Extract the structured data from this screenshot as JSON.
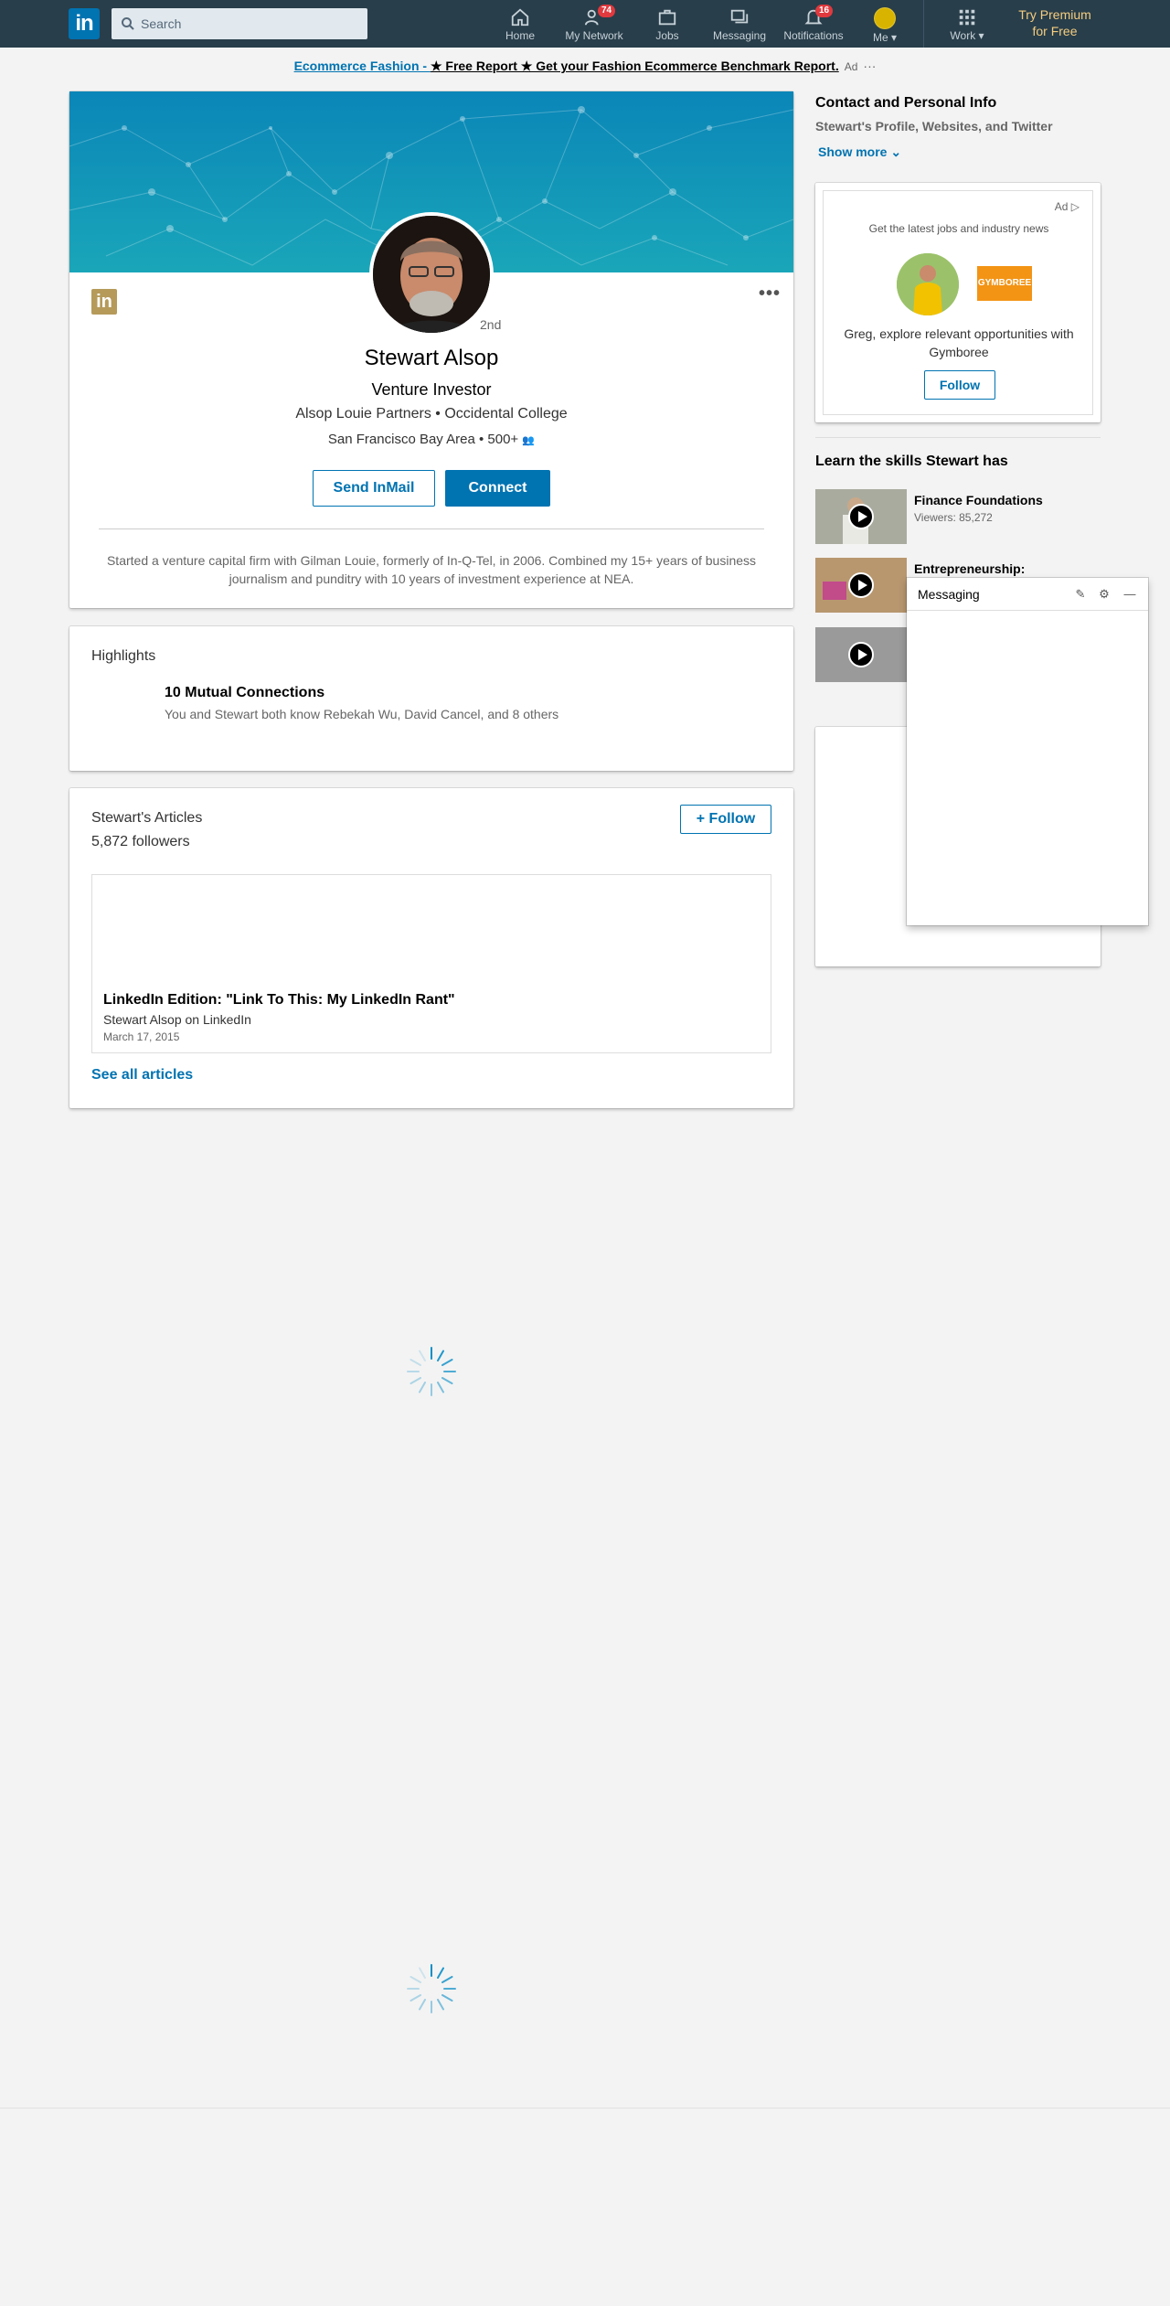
{
  "nav": {
    "logo": "in",
    "search_placeholder": "Search",
    "items": [
      {
        "label": "Home"
      },
      {
        "label": "My Network",
        "badge": "74"
      },
      {
        "label": "Jobs"
      },
      {
        "label": "Messaging"
      },
      {
        "label": "Notifications",
        "badge": "16"
      },
      {
        "label": "Me"
      },
      {
        "label": "Work"
      }
    ],
    "premium_line1": "Try Premium",
    "premium_line2": "for Free"
  },
  "adbar": {
    "link": "Ecommerce Fashion - ",
    "text": "★ Free Report ★ Get your Fashion Ecommerce Benchmark Report.",
    "tag": "Ad",
    "dots": "···"
  },
  "profile": {
    "badge_logo": "in",
    "degree": "2nd",
    "name": "Stewart Alsop",
    "headline": "Venture Investor",
    "education": "Alsop Louie Partners • Occidental College",
    "location": "San Francisco Bay Area • 500+",
    "send_inmail": "Send InMail",
    "connect": "Connect",
    "summary": "Started a venture capital firm with Gilman Louie, formerly of In-Q-Tel, in 2006. Combined my 15+ years of business journalism and punditry with 10 years of investment experience at NEA.",
    "more": "•••"
  },
  "highlights": {
    "title": "Highlights",
    "mutual_title": "10 Mutual Connections",
    "mutual_sub": "You and Stewart both know Rebekah Wu, David Cancel, and 8 others"
  },
  "articles": {
    "title": "Stewart's Articles",
    "followers": "5,872 followers",
    "follow": "+ Follow",
    "article_title": "LinkedIn Edition: \"Link To This: My LinkedIn Rant\"",
    "article_by": "Stewart Alsop on LinkedIn",
    "article_date": "March 17, 2015",
    "see_all": "See all articles"
  },
  "sidebar": {
    "contact_title": "Contact and Personal Info",
    "contact_sub": "Stewart's Profile, Websites, and Twitter",
    "show_more": "Show more",
    "ad": {
      "label": "Ad",
      "head": "Get the latest jobs and industry news",
      "brand": "GYMBOREE",
      "body": "Greg, explore relevant opportunities with Gymboree",
      "follow": "Follow"
    },
    "skills_title": "Learn the skills Stewart has",
    "courses": [
      {
        "title": "Finance Foundations",
        "views": "Viewers: 85,272"
      },
      {
        "title": "Entrepreneurship:",
        "views": ""
      },
      {
        "title": "",
        "views": ""
      }
    ]
  },
  "messaging": {
    "title": "Messaging"
  },
  "colors": {
    "nav_bg": "#283e4a",
    "brand_blue": "#0073b1",
    "premium_gold": "#f5cc7f",
    "badge_red": "#e0393e"
  }
}
